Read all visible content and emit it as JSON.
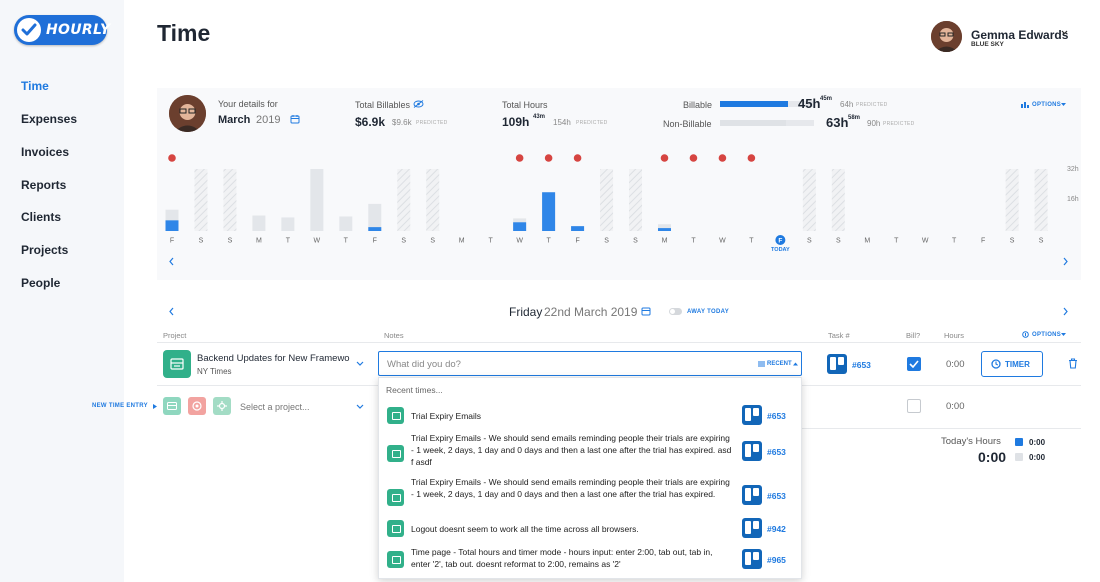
{
  "app": {
    "logo_text": "HOURLY",
    "page_title": "Time"
  },
  "sidebar": {
    "items": [
      {
        "label": "Time",
        "active": true
      },
      {
        "label": "Expenses"
      },
      {
        "label": "Invoices"
      },
      {
        "label": "Reports"
      },
      {
        "label": "Clients"
      },
      {
        "label": "Projects"
      },
      {
        "label": "People"
      }
    ]
  },
  "user": {
    "name": "Gemma Edwards",
    "org": "BLUE SKY"
  },
  "summary": {
    "details_label": "Your details for",
    "month": "March",
    "year": "2019",
    "billables_label": "Total Billables",
    "billables_value": "$6.9k",
    "billables_predicted": "$9.6k",
    "hours_label": "Total Hours",
    "hours_value": "109h",
    "hours_minutes": "43m",
    "hours_predicted": "154h",
    "predicted_label": "PREDICTED",
    "billable_label": "Billable",
    "billable_value": "45h",
    "billable_minutes": "45m",
    "billable_predicted": "64h",
    "billable_fraction": 0.72,
    "nonbillable_label": "Non-Billable",
    "nonbillable_value": "63h",
    "nonbillable_minutes": "58m",
    "nonbillable_predicted": "90h",
    "nonbillable_fraction": 0.7,
    "options_label": "OPTIONS"
  },
  "chart_data": {
    "type": "bar",
    "y_tick_labels": [
      "32h",
      "16h"
    ],
    "ylim": [
      0,
      32
    ],
    "today_label": "TODAY",
    "days": [
      {
        "letter": "F",
        "total": 11,
        "billed": 5.5,
        "dot": true
      },
      {
        "letter": "S",
        "weekend": true
      },
      {
        "letter": "S",
        "weekend": true
      },
      {
        "letter": "M",
        "total": 8,
        "billed": 0
      },
      {
        "letter": "T",
        "total": 7,
        "billed": 0
      },
      {
        "letter": "W",
        "total": 6000,
        "billed": 0
      },
      {
        "letter": "T",
        "total": 7.5,
        "billed": 0
      },
      {
        "letter": "F",
        "total": 14,
        "billed": 2,
        "dot": false
      },
      {
        "letter": "S",
        "weekend": true
      },
      {
        "letter": "S",
        "weekend": true
      },
      {
        "letter": "M",
        "total": 0,
        "billed": 0
      },
      {
        "letter": "T",
        "total": 0,
        "billed": 0
      },
      {
        "letter": "W",
        "total": 6.5,
        "billed": 4.5,
        "dot": true
      },
      {
        "letter": "T",
        "total": 20,
        "billed": 20,
        "dot": true
      },
      {
        "letter": "F",
        "total": 2.5,
        "billed": 2.5,
        "dot": true
      },
      {
        "letter": "S",
        "weekend": true
      },
      {
        "letter": "S",
        "weekend": true
      },
      {
        "letter": "M",
        "total": 3.5,
        "billed": 1.5,
        "dot": true
      },
      {
        "letter": "T",
        "total": 0,
        "billed": 0,
        "dot": true
      },
      {
        "letter": "W",
        "total": 0,
        "billed": 0,
        "dot": true
      },
      {
        "letter": "T",
        "total": 0,
        "billed": 0,
        "dot": true
      },
      {
        "letter": "F",
        "total": 0,
        "billed": 0,
        "today": true
      },
      {
        "letter": "S",
        "weekend": true
      },
      {
        "letter": "S",
        "weekend": true
      },
      {
        "letter": "M",
        "total": 0,
        "billed": 0
      },
      {
        "letter": "T",
        "total": 0,
        "billed": 0
      },
      {
        "letter": "W",
        "total": 0,
        "billed": 0
      },
      {
        "letter": "T",
        "total": 0,
        "billed": 0
      },
      {
        "letter": "F",
        "total": 0,
        "billed": 0
      },
      {
        "letter": "S",
        "weekend": true
      },
      {
        "letter": "S",
        "weekend": true
      }
    ]
  },
  "day": {
    "weekday": "Friday",
    "date": "22nd March 2019",
    "away_label": "AWAY TODAY"
  },
  "columns": {
    "project": "Project",
    "notes": "Notes",
    "task": "Task #",
    "bill": "Bill?",
    "hours": "Hours",
    "options": "OPTIONS"
  },
  "entry": {
    "project": "Backend Updates for New Framewo",
    "client": "NY Times",
    "notes_placeholder": "What did you do?",
    "recent_label": "RECENT",
    "task": "#653",
    "hours": "0:00",
    "timer_label": "TIMER"
  },
  "new_entry": {
    "label": "NEW TIME ENTRY",
    "project_placeholder": "Select a project...",
    "hours": "0:00"
  },
  "dropdown": {
    "header": "Recent times...",
    "items": [
      {
        "text": "Trial Expiry Emails",
        "task": "#653"
      },
      {
        "text": "Trial Expiry Emails - We should send emails reminding people their trials are expiring - 1 week, 2 days, 1 day and 0 days and then a last one after the trial has expired. asd f asdf",
        "task": "#653"
      },
      {
        "text": "Trial Expiry Emails - We should send emails reminding people their trials are expiring - 1 week, 2 days, 1 day and 0 days and then a last one after the trial has expired.",
        "task": "#653"
      },
      {
        "text": "Logout doesnt seem to work all the time across all browsers.",
        "task": "#942"
      },
      {
        "text": "Time page - Total hours and timer mode - hours input: enter 2:00, tab out, tab in, enter '2', tab out. doesnt reformat to 2:00, remains as '2'",
        "task": "#965"
      }
    ]
  },
  "today_hours": {
    "label": "Today's Hours",
    "value": "0:00",
    "billable": "0:00",
    "nonbillable": "0:00"
  },
  "colors": {
    "accent": "#1f7ae0",
    "dot": "#d64541",
    "project_green": "#31b08a",
    "trello": "#1266b8"
  }
}
